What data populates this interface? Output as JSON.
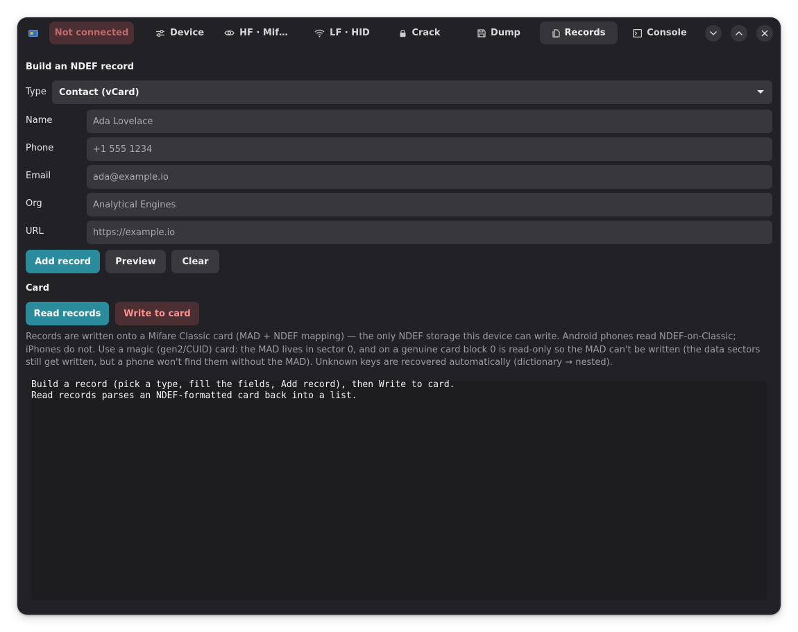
{
  "window": {
    "status": "Not connected",
    "tabs": [
      {
        "label": "Device",
        "icon": "sliders-icon",
        "active": false
      },
      {
        "label": "HF · Mif…",
        "icon": "eye-icon",
        "active": false
      },
      {
        "label": "LF · HID",
        "icon": "wifi-icon",
        "active": false
      },
      {
        "label": "Crack",
        "icon": "lock-icon",
        "active": false
      },
      {
        "label": "Dump",
        "icon": "save-icon",
        "active": false
      },
      {
        "label": "Records",
        "icon": "copy-icon",
        "active": true
      },
      {
        "label": "Console",
        "icon": "terminal-icon",
        "active": false
      }
    ],
    "controls": [
      "minimize-icon",
      "maximize-icon",
      "close-icon"
    ]
  },
  "builder": {
    "title": "Build an NDEF record",
    "type_label": "Type",
    "type_value": "Contact (vCard)",
    "fields": [
      {
        "label": "Name",
        "placeholder": "Ada Lovelace"
      },
      {
        "label": "Phone",
        "placeholder": "+1 555 1234"
      },
      {
        "label": "Email",
        "placeholder": "ada@example.io"
      },
      {
        "label": "Org",
        "placeholder": "Analytical Engines"
      },
      {
        "label": "URL",
        "placeholder": "https://example.io"
      }
    ],
    "add_label": "Add record",
    "preview_label": "Preview",
    "clear_label": "Clear"
  },
  "card": {
    "title": "Card",
    "read_label": "Read records",
    "write_label": "Write to card",
    "info": "Records are written onto a Mifare Classic card (MAD + NDEF mapping) — the only NDEF storage this device can write. Android phones read NDEF-on-Classic; iPhones do not. Use a magic (gen2/CUID) card: the MAD lives in sector 0, and on a genuine card block 0 is read-only so the MAD can't be written (the data sectors still get written, but a phone won't find them without the MAD). Unknown keys are recovered automatically (dictionary → nested).",
    "log": [
      "Build a record (pick a type, fill the fields, Add record), then Write to card.",
      "Read records parses an NDEF-formatted card back into a list."
    ]
  },
  "colors": {
    "window_bg": "#222226",
    "accent": "#2a8b9d",
    "danger_text": "#ff8f8f",
    "danger_bg": "#4b2f33"
  }
}
